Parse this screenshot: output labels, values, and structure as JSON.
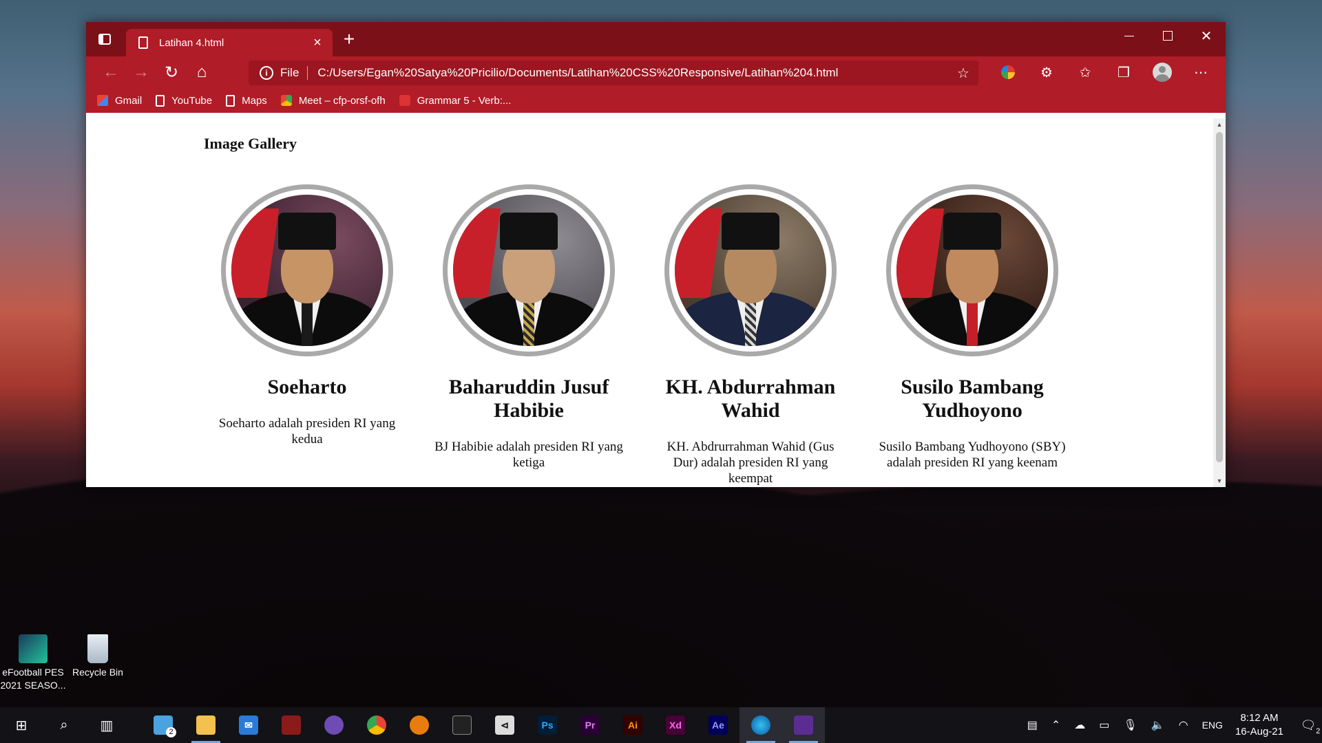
{
  "browser": {
    "tab_title": "Latihan 4.html",
    "address_scheme_label": "File",
    "url": "C:/Users/Egan%20Satya%20Pricilio/Documents/Latihan%20CSS%20Responsive/Latihan%204.html",
    "bookmarks": [
      "Gmail",
      "YouTube",
      "Maps",
      "Meet – cfp-orsf-ofh",
      "Grammar 5 - Verb:..."
    ]
  },
  "page": {
    "title": "Image Gallery",
    "cards": [
      {
        "name": "Soeharto",
        "desc": "Soeharto adalah presiden RI yang kedua"
      },
      {
        "name": "Baharuddin Jusuf Habibie",
        "desc": "BJ Habibie adalah presiden RI yang ketiga"
      },
      {
        "name": "KH. Abdurrahman Wahid",
        "desc": "KH. Abdrurrahman Wahid (Gus Dur) adalah presiden RI yang keempat"
      },
      {
        "name": "Susilo Bambang Yudhoyono",
        "desc": "Susilo Bambang Yudhoyono (SBY) adalah presiden RI yang keenam"
      }
    ]
  },
  "desktop": {
    "icons": [
      {
        "label": "eFootball PES 2021 SEASO..."
      },
      {
        "label": "Recycle Bin"
      }
    ]
  },
  "taskbar": {
    "apps": [
      "Ps",
      "Pr",
      "Ai",
      "Xd",
      "Ae"
    ],
    "badge_count": "2",
    "language": "ENG",
    "time": "8:12 AM",
    "date": "16-Aug-21",
    "notification_count": "2"
  },
  "colors": {
    "titlebar": "#7c1018",
    "toolbar": "#b01c27",
    "frame_ring": "#a9a9a9"
  }
}
